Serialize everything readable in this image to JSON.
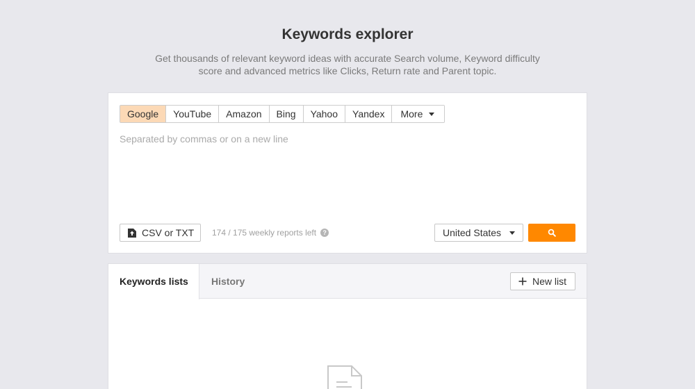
{
  "header": {
    "title": "Keywords explorer",
    "subtitle_line1": "Get thousands of relevant keyword ideas with accurate Search volume, Keyword difficulty",
    "subtitle_line2": "score and advanced metrics like Clicks, Return rate and Parent topic."
  },
  "search_engines": {
    "selected": "Google",
    "items": [
      "Google",
      "YouTube",
      "Amazon",
      "Bing",
      "Yahoo",
      "Yandex"
    ],
    "more_label": "More"
  },
  "keywords_input": {
    "value": "",
    "placeholder": "Separated by commas or on a new line"
  },
  "upload": {
    "label": "CSV or TXT",
    "icon": "upload-file-icon"
  },
  "reports": {
    "text": "174 / 175 weekly reports left",
    "icon": "help-circle-icon"
  },
  "country_select": {
    "selected": "United States"
  },
  "search_button": {
    "icon": "search-icon"
  },
  "lists": {
    "tabs": [
      "Keywords lists",
      "History"
    ],
    "active_tab": "Keywords lists",
    "new_list_label": "New list",
    "new_list_icon": "plus-icon",
    "empty_icon": "document-icon"
  },
  "colors": {
    "accent": "#ff8800",
    "selected_engine_bg": "#fcd9b6",
    "page_bg": "#e8e8ed"
  }
}
